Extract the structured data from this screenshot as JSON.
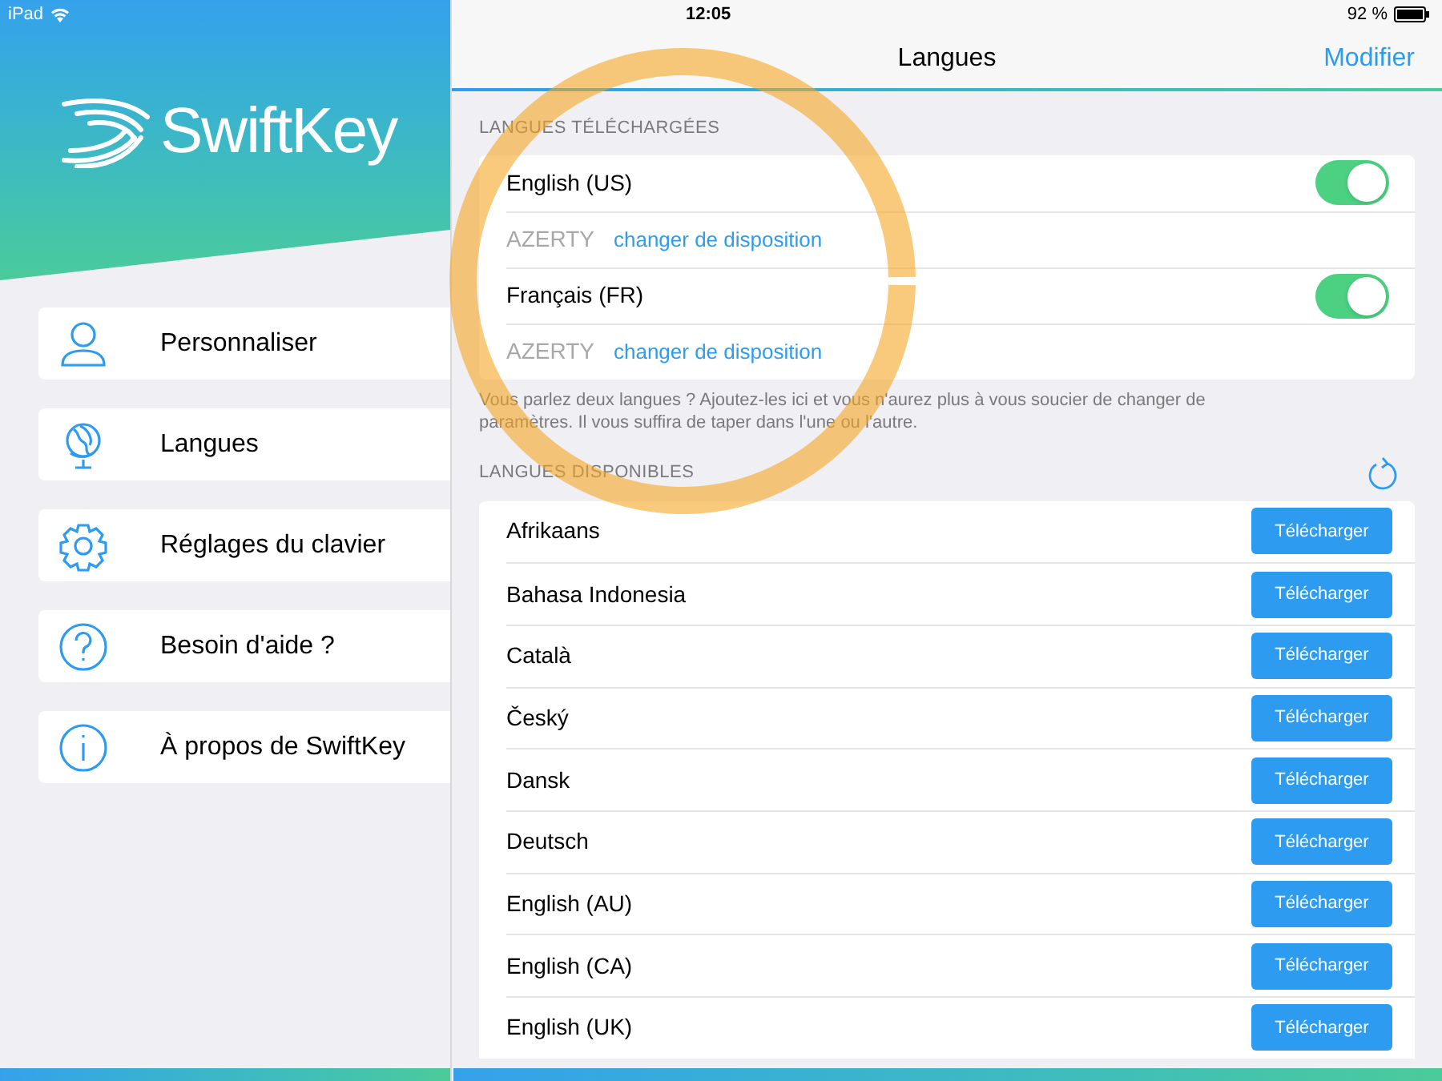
{
  "status_bar": {
    "device": "iPad",
    "time": "12:05",
    "battery": "92 %"
  },
  "sidebar": {
    "logo": "SwiftKey",
    "items": [
      {
        "kind": "person",
        "label": "Personnaliser",
        "selected": false
      },
      {
        "kind": "globe",
        "label": "Langues",
        "selected": false
      },
      {
        "kind": "gear",
        "label": "Réglages du clavier",
        "selected": false
      },
      {
        "kind": "help",
        "label": "Besoin d'aide ?",
        "selected": false
      },
      {
        "kind": "info",
        "label": "À propos de SwiftKey",
        "selected": false
      }
    ]
  },
  "nav": {
    "title": "Langues",
    "action": "Modifier"
  },
  "downloaded": {
    "header": "LANGUES TÉLÉCHARGÉES",
    "languages": [
      {
        "name": "English (US)",
        "on": true,
        "layout": "AZERTY",
        "layout_link": "changer de disposition"
      },
      {
        "name": "Français (FR)",
        "on": true,
        "layout": "AZERTY",
        "layout_link": "changer de disposition"
      }
    ],
    "footer": "Vous parlez deux langues ? Ajoutez-les ici et vous n'aurez plus à vous soucier de changer de paramètres. Il vous suffira de taper dans l'une ou l'autre."
  },
  "available": {
    "header": "LANGUES DISPONIBLES",
    "languages": [
      {
        "name": "Afrikaans",
        "button": "Télécharger"
      },
      {
        "name": "Bahasa Indonesia",
        "button": "Télécharger"
      },
      {
        "name": "Català",
        "button": "Télécharger"
      },
      {
        "name": "Český",
        "button": "Télécharger"
      },
      {
        "name": "Dansk",
        "button": "Télécharger"
      },
      {
        "name": "Deutsch",
        "button": "Télécharger"
      },
      {
        "name": "English (AU)",
        "button": "Télécharger"
      },
      {
        "name": "English (CA)",
        "button": "Télécharger"
      },
      {
        "name": "English (UK)",
        "button": "Télécharger"
      }
    ]
  }
}
